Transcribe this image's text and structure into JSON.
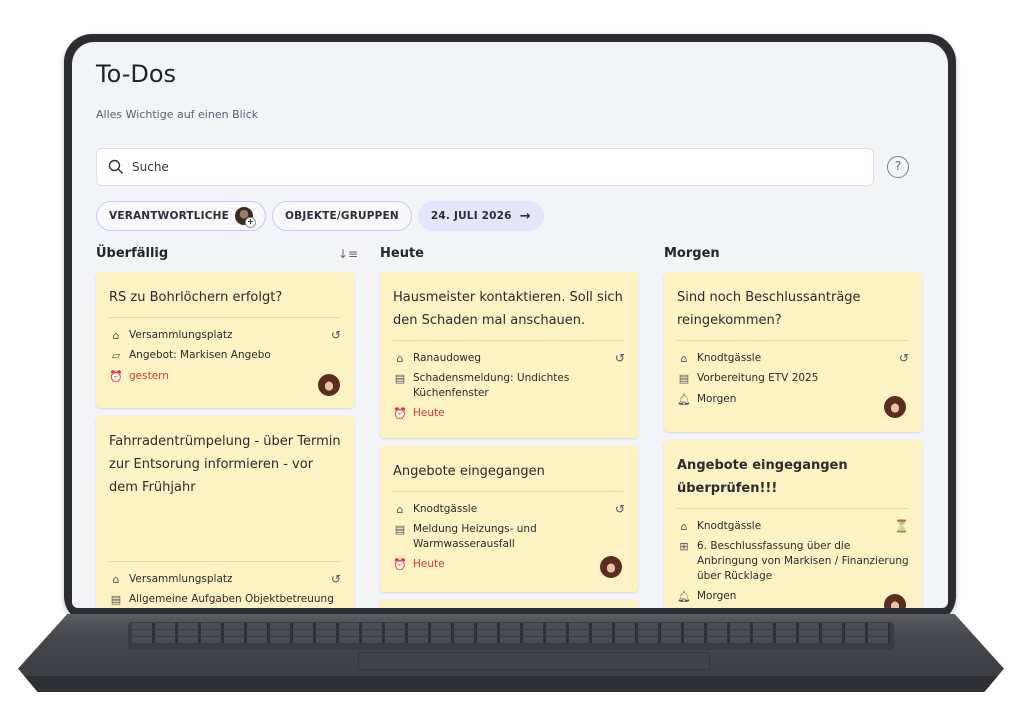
{
  "app": {
    "title": "To-Dos",
    "subtitle": "Alles Wichtige auf einen Blick"
  },
  "search": {
    "placeholder": "Suche"
  },
  "help": {
    "icon": "help-circle-icon",
    "label": "?"
  },
  "filters": {
    "responsible": "VERANTWORTLICHE",
    "objects": "OBJEKTE/GRUPPEN",
    "date": "24. JULI 2026"
  },
  "columns": [
    {
      "title": "Überfällig"
    },
    {
      "title": "Heute"
    },
    {
      "title": "Morgen"
    }
  ],
  "cards": {
    "overdue": [
      {
        "title": "RS zu Bohrlöchern erfolgt?",
        "location": "Versammlungsplatz",
        "reference": "Angebot: Markisen Angebo",
        "due": "gestern"
      },
      {
        "title": "Fahrradentrümpelung - über Termin zur Entsorung informieren - vor dem Frühjahr",
        "location": "Versammlungsplatz",
        "reference": "Allgemeine Aufgaben Objektbetreuung"
      }
    ],
    "today": [
      {
        "title": "Hausmeister kontaktieren. Soll sich den Schaden mal anschauen.",
        "location": "Ranaudoweg",
        "reference": "Schadensmeldung: Undichtes Küchenfenster",
        "due": "Heute"
      },
      {
        "title": "Angebote eingegangen",
        "location": "Knodtgässle",
        "reference": "Meldung Heizungs- und Warmwasserausfall",
        "due": "Heute"
      }
    ],
    "tomorrow": [
      {
        "title": "Sind noch Beschlussanträge reingekommen?",
        "location": "Knodtgässle",
        "reference": "Vorbereitung ETV 2025",
        "due": "Morgen"
      },
      {
        "title": "Angebote eingegangen überprüfen!!!",
        "location": "Knodtgässle",
        "reference": "6. Beschlussfassung über die Anbringung von Markisen / Finanzierung über Rücklage",
        "due": "Morgen"
      }
    ]
  },
  "colors": {
    "card": "#fdf2c4",
    "overdue": "#d03a3a",
    "accent_chip": "#e5e6fb",
    "chip_border": "#c5c9f0"
  }
}
